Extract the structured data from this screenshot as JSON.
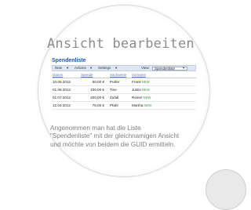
{
  "slide": {
    "heading": "Ansicht bearbeiten",
    "caption_lines": [
      "Angenommen man hat die Liste",
      "\"Spendenliste\" mit der gleichnamigen Ansicht",
      "und möchte von beidem die GUID ermitteln."
    ]
  },
  "list": {
    "title": "Spendenliste",
    "toolbar": {
      "new": "New",
      "actions": "Actions",
      "settings": "Settings",
      "view_label": "View:",
      "view_value": "Spendenliste"
    },
    "columns": [
      "Datum",
      "Spende",
      "Sachwerte",
      "Vorname"
    ],
    "rows": [
      {
        "datum": "10.09.2012",
        "spende": "50,00 €",
        "sachwerte": "Purfer",
        "vorname": "Frank",
        "badge": "NEW"
      },
      {
        "datum": "01.08.2012",
        "spende": "100,00 €",
        "sachwerte": "Tine",
        "vorname": "Justin",
        "badge": "NEW"
      },
      {
        "datum": "01.07.2012",
        "spende": "200,00 €",
        "sachwerte": "Zufall",
        "vorname": "Reiner",
        "badge": "NEW"
      },
      {
        "datum": "12.04.2012",
        "spende": "75,00 €",
        "sachwerte": "Pfahl",
        "vorname": "Martha",
        "badge": "NEW"
      }
    ]
  },
  "colors": {
    "heading": "#8c8c8c",
    "link": "#1e58a6",
    "new_badge": "#3a9a3a",
    "toolbar_bg": "#dde6f2"
  },
  "icons": [
    "magnifier-lens-icon"
  ]
}
